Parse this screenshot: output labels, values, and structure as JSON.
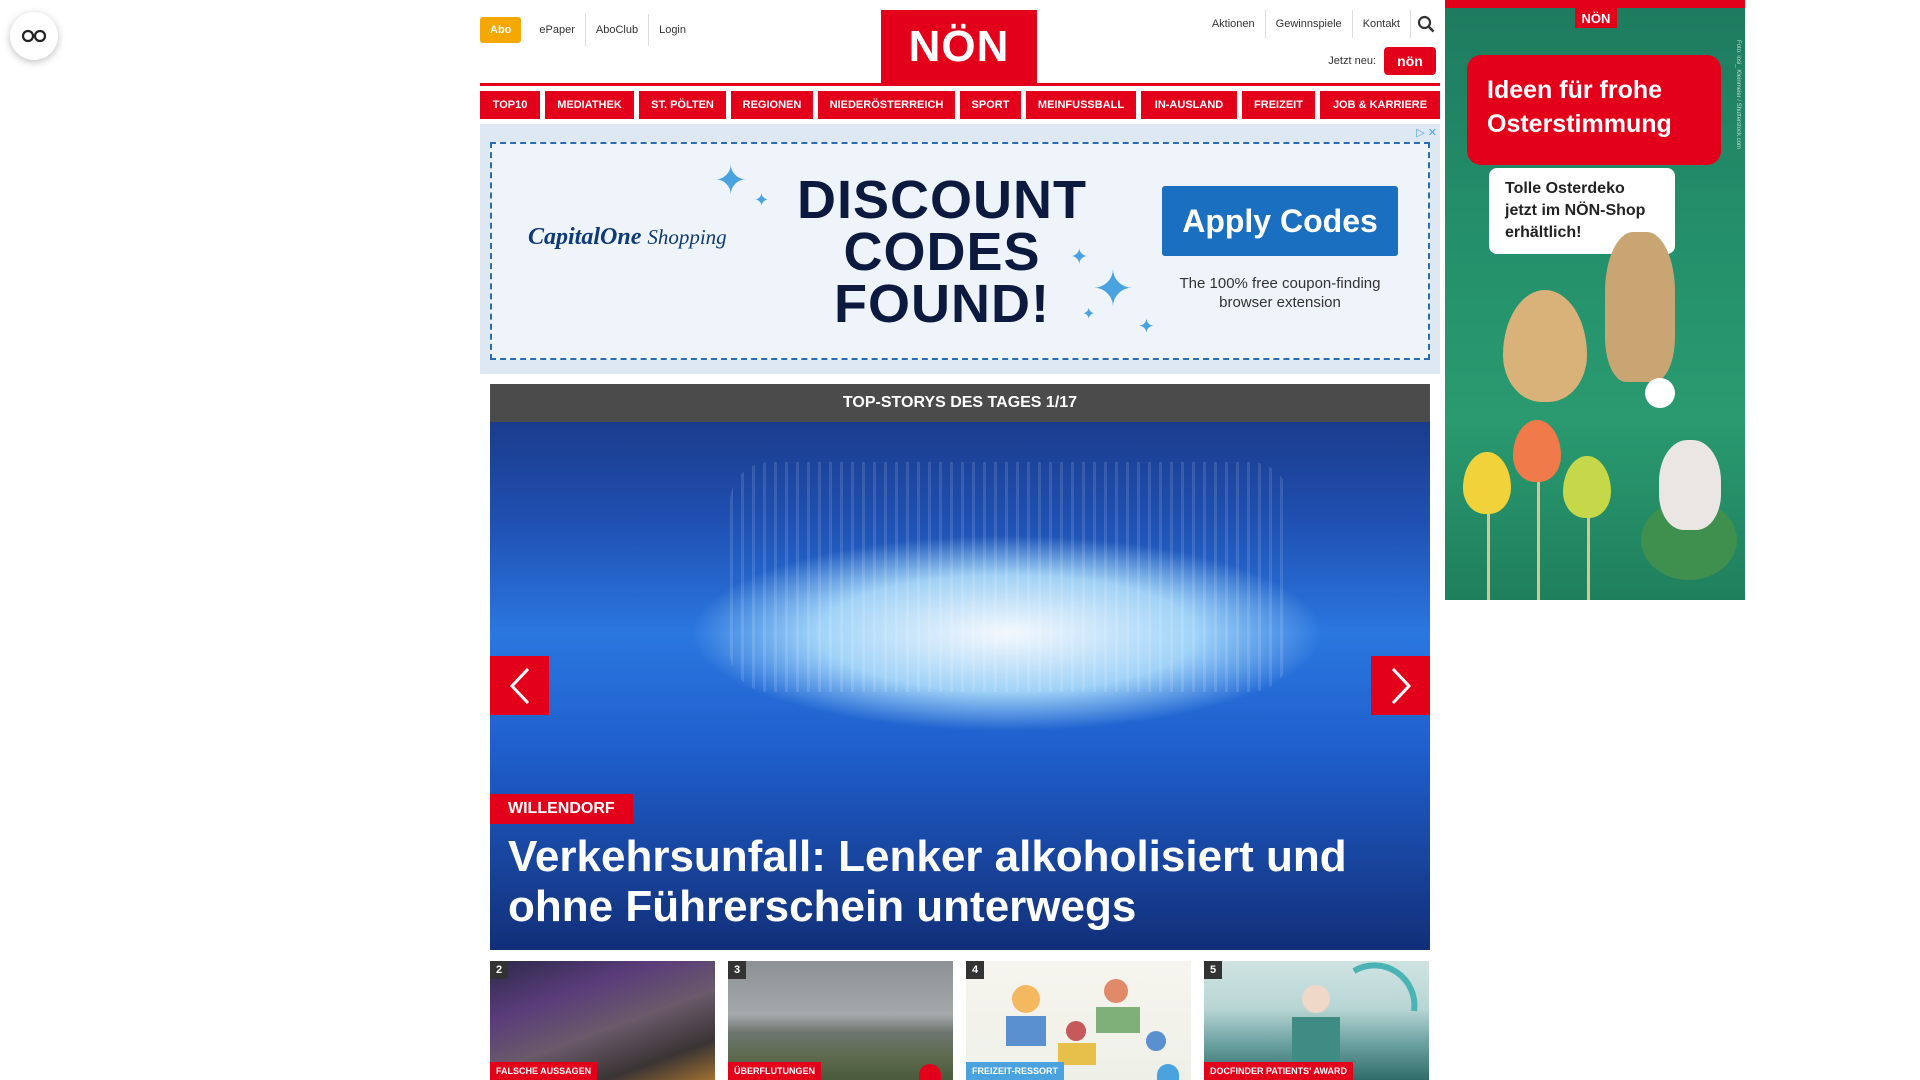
{
  "header": {
    "abo_label": "Abo",
    "top_links": [
      "ePaper",
      "AboClub",
      "Login"
    ],
    "logo_text": "NÖN",
    "right_links": [
      "Aktionen",
      "Gewinnspiele",
      "Kontakt"
    ],
    "jetzt_label": "Jetzt neu:",
    "jetzt_badge": "nön"
  },
  "nav": {
    "items": [
      "TOP10",
      "MEDIATHEK",
      "ST. PÖLTEN",
      "REGIONEN",
      "NIEDERÖSTERREICH",
      "SPORT",
      "MEINFUSSBALL",
      "IN-AUSLAND",
      "FREIZEIT",
      "JOB & KARRIERE"
    ]
  },
  "ad": {
    "brand_main": "CapitalOne",
    "brand_sub": "Shopping",
    "headline_lines": [
      "DISCOUNT",
      "CODES",
      "FOUND!"
    ],
    "button_label": "Apply Codes",
    "subtext": "The 100% free coupon-finding browser extension",
    "close_glyph": "▷ ✕"
  },
  "top_stories": {
    "header": "TOP-STORYS DES TAGES 1/17",
    "tag": "WILLENDORF",
    "title": "Verkehrsunfall: Lenker alkoholisiert und ohne Führerschein unterwegs"
  },
  "thumbnails": [
    {
      "num": "2",
      "label": "FALSCHE AUSSAGEN"
    },
    {
      "num": "3",
      "label": "ÜBERFLUTUNGEN"
    },
    {
      "num": "4",
      "label": "FREIZEIT-RESSORT"
    },
    {
      "num": "5",
      "label": "DOCFINDER PATIENTS' AWARD"
    }
  ],
  "side_ad": {
    "logo": "NÖN",
    "bubble_text": "Ideen für frohe Osterstimmung",
    "card_text": "Tolle Osterdeko jetzt im NÖN-Shop erhältlich!",
    "credit": "Foto: iosi_ Kleinmeier / Shutterstock.com"
  },
  "colors": {
    "brand_red": "#e2001a",
    "abo_orange": "#f5a800",
    "ad_blue": "#1a6fc0",
    "topstory_bar": "#4b4b4b"
  }
}
